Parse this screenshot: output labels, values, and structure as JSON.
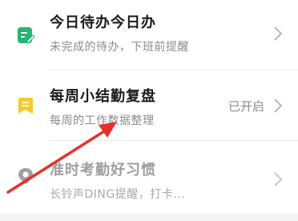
{
  "items": [
    {
      "title": "今日待办今日办",
      "subtitle": "未完成的待办，下班前提醒",
      "status": "",
      "icon": "todo-edit-icon",
      "icon_color": "#22b573"
    },
    {
      "title": "每周小结勤复盘",
      "subtitle": "每周的工作数据整理",
      "status": "已开启",
      "icon": "bookmark-list-icon",
      "icon_color": "#f7c925"
    },
    {
      "title": "准时考勤好习惯",
      "subtitle": "长铃声DING提醒，打卡...",
      "status": "",
      "icon": "location-pin-icon",
      "icon_color": "#a0a0a0"
    }
  ],
  "annotation_color": "#e8302a",
  "chevron_color": "#b8b8b8"
}
